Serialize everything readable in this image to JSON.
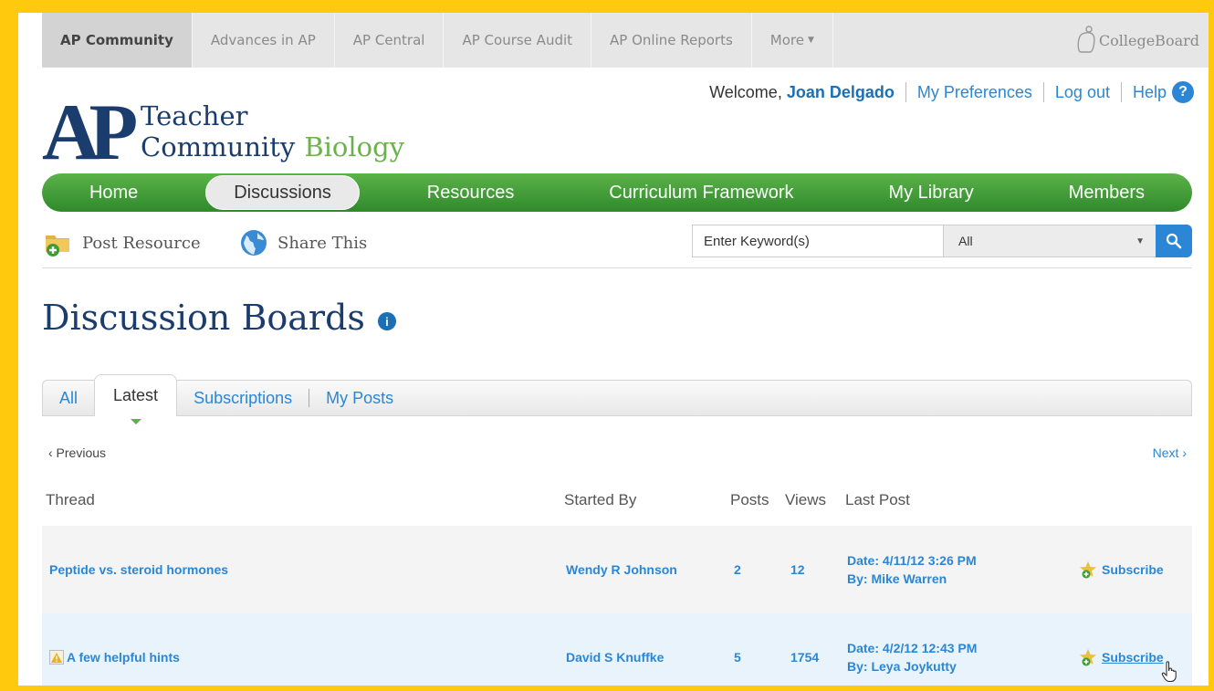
{
  "topbar": {
    "items": [
      {
        "label": "AP Community"
      },
      {
        "label": "Advances in AP"
      },
      {
        "label": "AP Central"
      },
      {
        "label": "AP Course Audit"
      },
      {
        "label": "AP Online Reports"
      },
      {
        "label": "More"
      }
    ],
    "brand": "CollegeBoard"
  },
  "header": {
    "welcome_text": "Welcome,",
    "user_name": "Joan Delgado",
    "preferences": "My Preferences",
    "logout": "Log out",
    "help": "Help",
    "help_icon_glyph": "?"
  },
  "logo": {
    "mark": "AP",
    "line1": "Teacher",
    "line2": "Community",
    "subject": "Biology"
  },
  "nav": {
    "items": [
      {
        "label": "Home"
      },
      {
        "label": "Discussions"
      },
      {
        "label": "Resources"
      },
      {
        "label": "Curriculum Framework"
      },
      {
        "label": "My Library"
      },
      {
        "label": "Members"
      }
    ]
  },
  "toolbar": {
    "post_resource": "Post Resource",
    "share_this": "Share This",
    "search_placeholder": "Enter Keyword(s)",
    "search_scope": "All"
  },
  "page": {
    "title": "Discussion Boards",
    "info_glyph": "i"
  },
  "tabs": [
    {
      "label": "All"
    },
    {
      "label": "Latest"
    },
    {
      "label": "Subscriptions"
    },
    {
      "label": "My Posts"
    }
  ],
  "pager": {
    "prev": "‹ Previous",
    "next": "Next ›"
  },
  "table": {
    "headers": {
      "thread": "Thread",
      "started_by": "Started By",
      "posts": "Posts",
      "views": "Views",
      "last_post": "Last Post"
    },
    "rows": [
      {
        "thread": "Peptide vs. steroid hormones",
        "started_by": "Wendy R Johnson",
        "posts": "2",
        "views": "12",
        "last_date": "Date: 4/11/12 3:26 PM",
        "last_by": "By: Mike Warren",
        "action": "Subscribe"
      },
      {
        "thread": "A few helpful hints",
        "started_by": "David S Knuffke",
        "posts": "5",
        "views": "1754",
        "last_date": "Date: 4/2/12 12:43 PM",
        "last_by": "By: Leya Joykutty",
        "action": "Subscribe"
      }
    ]
  },
  "colors": {
    "frame": "#ffc90e",
    "nav_green": "#3f9b35",
    "brand_navy": "#1b3d6e",
    "link_blue": "#2b86d6"
  },
  "icons": [
    "chevron-down-icon",
    "collegeboard-acorn-icon",
    "help-icon",
    "folder-add-icon",
    "globe-icon",
    "search-icon",
    "info-icon",
    "hot-thread-icon",
    "star-add-icon",
    "hand-cursor-icon"
  ]
}
